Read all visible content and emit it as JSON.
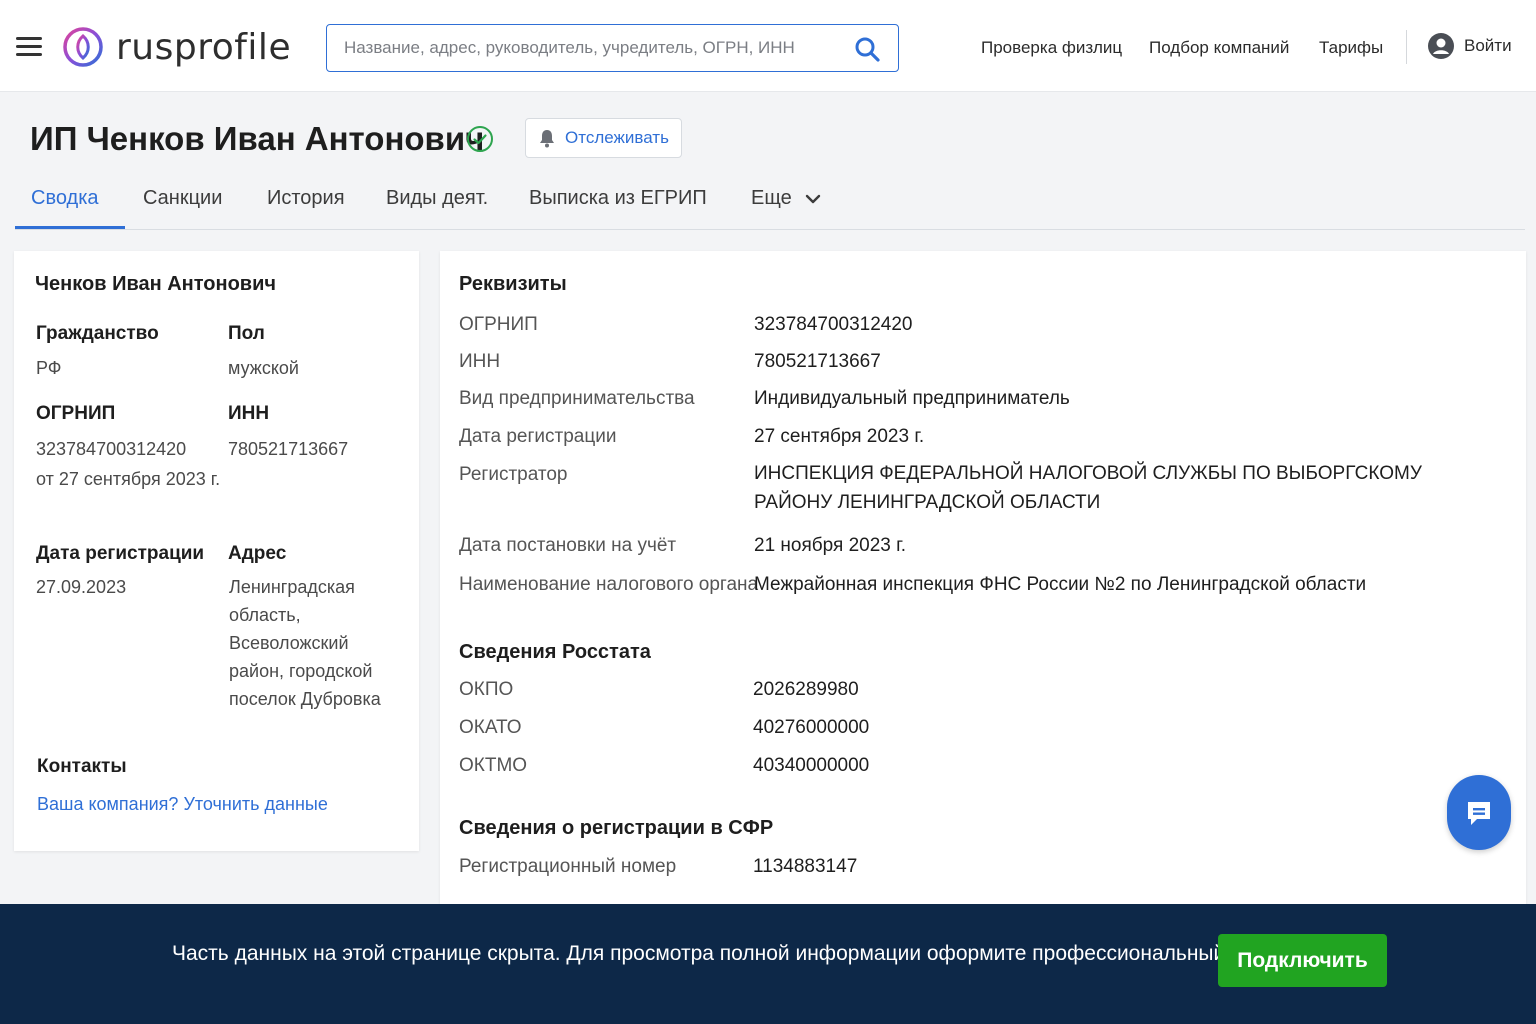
{
  "header": {
    "logo_text": "rusprofile",
    "search_placeholder": "Название, адрес, руководитель, учредитель, ОГРН, ИНН",
    "nav": [
      "Проверка физлиц",
      "Подбор компаний",
      "Тарифы"
    ],
    "login_label": "Войти"
  },
  "page": {
    "title": "ИП Ченков Иван Антонович",
    "track_label": "Отслеживать",
    "tabs": [
      "Сводка",
      "Санкции",
      "История",
      "Виды деят.",
      "Выписка из ЕГРИП",
      "Еще"
    ],
    "active_tab": 0
  },
  "summary": {
    "name": "Ченков Иван Антонович",
    "citizenship_label": "Гражданство",
    "citizenship_value": "РФ",
    "gender_label": "Пол",
    "gender_value": "мужской",
    "ogrnip_label": "ОГРНИП",
    "ogrnip_value": "323784700312420",
    "ogrnip_date": "от 27 сентября 2023 г.",
    "inn_label": "ИНН",
    "inn_value": "780521713667",
    "reg_date_label": "Дата регистрации",
    "reg_date_value": "27.09.2023",
    "address_label": "Адрес",
    "address_lines": [
      "Ленинградская",
      "область,",
      "Всеволожский",
      "район, городской",
      "поселок Дубровка"
    ],
    "contacts_label": "Контакты",
    "contacts_link": "Ваша компания? Уточнить данные"
  },
  "requisites": {
    "title": "Реквизиты",
    "rows": [
      {
        "k": "ОГРНИП",
        "v": "323784700312420"
      },
      {
        "k": "ИНН",
        "v": "780521713667"
      },
      {
        "k": "Вид предпринимательства",
        "v": "Индивидуальный предприниматель"
      },
      {
        "k": "Дата регистрации",
        "v": "27 сентября 2023 г."
      },
      {
        "k": "Регистратор",
        "v": "ИНСПЕКЦИЯ ФЕДЕРАЛЬНОЙ НАЛОГОВОЙ СЛУЖБЫ ПО ВЫБОРГСКОМУ РАЙОНУ ЛЕНИНГРАДСКОЙ ОБЛАСТИ"
      },
      {
        "k": "Дата постановки на учёт",
        "v": "21 ноября 2023 г."
      },
      {
        "k": "Наименование налогового органа",
        "v": "Межрайонная инспекция ФНС России №2 по Ленинградской области"
      }
    ]
  },
  "rosstat": {
    "title": "Сведения Росстата",
    "rows": [
      {
        "k": "ОКПО",
        "v": "2026289980"
      },
      {
        "k": "ОКАТО",
        "v": "40276000000"
      },
      {
        "k": "ОКТМО",
        "v": "40340000000"
      }
    ]
  },
  "sfr": {
    "title": "Сведения о регистрации в СФР",
    "rows": [
      {
        "k": "Регистрационный номер",
        "v": "1134883147"
      }
    ]
  },
  "banner": {
    "text": "Часть данных на этой странице скрыта. Для просмотра полной информации оформите профессиональный доступ",
    "button": "Подключить"
  },
  "colors": {
    "accent": "#2f6fd6",
    "banner_bg": "#0d2848",
    "cta": "#21a421",
    "verified": "#2ea44f"
  }
}
